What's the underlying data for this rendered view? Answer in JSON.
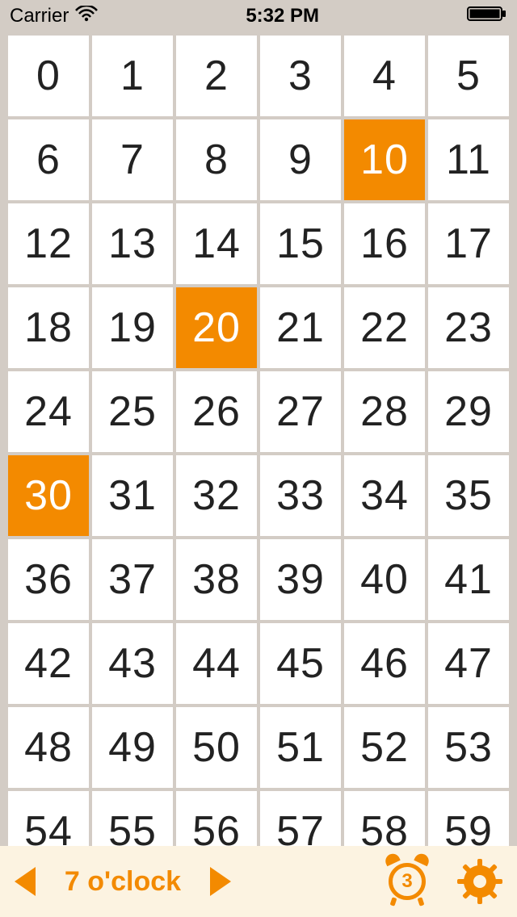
{
  "status_bar": {
    "carrier": "Carrier",
    "time": "5:32 PM"
  },
  "grid": {
    "columns": 6,
    "cells": [
      {
        "value": "0",
        "selected": false
      },
      {
        "value": "1",
        "selected": false
      },
      {
        "value": "2",
        "selected": false
      },
      {
        "value": "3",
        "selected": false
      },
      {
        "value": "4",
        "selected": false
      },
      {
        "value": "5",
        "selected": false
      },
      {
        "value": "6",
        "selected": false
      },
      {
        "value": "7",
        "selected": false
      },
      {
        "value": "8",
        "selected": false
      },
      {
        "value": "9",
        "selected": false
      },
      {
        "value": "10",
        "selected": true
      },
      {
        "value": "11",
        "selected": false
      },
      {
        "value": "12",
        "selected": false
      },
      {
        "value": "13",
        "selected": false
      },
      {
        "value": "14",
        "selected": false
      },
      {
        "value": "15",
        "selected": false
      },
      {
        "value": "16",
        "selected": false
      },
      {
        "value": "17",
        "selected": false
      },
      {
        "value": "18",
        "selected": false
      },
      {
        "value": "19",
        "selected": false
      },
      {
        "value": "20",
        "selected": true
      },
      {
        "value": "21",
        "selected": false
      },
      {
        "value": "22",
        "selected": false
      },
      {
        "value": "23",
        "selected": false
      },
      {
        "value": "24",
        "selected": false
      },
      {
        "value": "25",
        "selected": false
      },
      {
        "value": "26",
        "selected": false
      },
      {
        "value": "27",
        "selected": false
      },
      {
        "value": "28",
        "selected": false
      },
      {
        "value": "29",
        "selected": false
      },
      {
        "value": "30",
        "selected": true
      },
      {
        "value": "31",
        "selected": false
      },
      {
        "value": "32",
        "selected": false
      },
      {
        "value": "33",
        "selected": false
      },
      {
        "value": "34",
        "selected": false
      },
      {
        "value": "35",
        "selected": false
      },
      {
        "value": "36",
        "selected": false
      },
      {
        "value": "37",
        "selected": false
      },
      {
        "value": "38",
        "selected": false
      },
      {
        "value": "39",
        "selected": false
      },
      {
        "value": "40",
        "selected": false
      },
      {
        "value": "41",
        "selected": false
      },
      {
        "value": "42",
        "selected": false
      },
      {
        "value": "43",
        "selected": false
      },
      {
        "value": "44",
        "selected": false
      },
      {
        "value": "45",
        "selected": false
      },
      {
        "value": "46",
        "selected": false
      },
      {
        "value": "47",
        "selected": false
      },
      {
        "value": "48",
        "selected": false
      },
      {
        "value": "49",
        "selected": false
      },
      {
        "value": "50",
        "selected": false
      },
      {
        "value": "51",
        "selected": false
      },
      {
        "value": "52",
        "selected": false
      },
      {
        "value": "53",
        "selected": false
      },
      {
        "value": "54",
        "selected": false
      },
      {
        "value": "55",
        "selected": false
      },
      {
        "value": "56",
        "selected": false
      },
      {
        "value": "57",
        "selected": false
      },
      {
        "value": "58",
        "selected": false
      },
      {
        "value": "59",
        "selected": false
      }
    ]
  },
  "toolbar": {
    "hour_label": "7 o'clock",
    "alarm_count": "3"
  },
  "colors": {
    "accent": "#f38a00",
    "toolbar_bg": "#fcf3e1",
    "page_bg": "#d3ccc5",
    "cell_bg": "#ffffff"
  }
}
